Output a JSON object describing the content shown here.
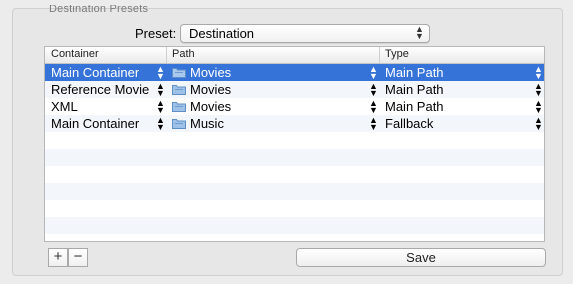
{
  "group": {
    "title": "Destination Presets"
  },
  "preset": {
    "label": "Preset:",
    "value": "Destination"
  },
  "table": {
    "headers": [
      "Container",
      "Path",
      "Type"
    ],
    "rows": [
      {
        "container": "Main Container",
        "path": "Movies",
        "type": "Main Path",
        "selected": true
      },
      {
        "container": "Reference Movie",
        "path": "Movies",
        "type": "Main Path",
        "selected": false
      },
      {
        "container": "XML",
        "path": "Movies",
        "type": "Main Path",
        "selected": false
      },
      {
        "container": "Main Container",
        "path": "Music",
        "type": "Fallback",
        "selected": false
      }
    ],
    "stepper_glyph": "⬍"
  },
  "buttons": {
    "add": "+",
    "remove": "−",
    "save": "Save"
  },
  "colors": {
    "selection": "#3673d8",
    "folder": "#9ec1e8"
  },
  "icons": {
    "folder": "folder-icon",
    "popup_arrows": "popup-arrows-icon"
  }
}
